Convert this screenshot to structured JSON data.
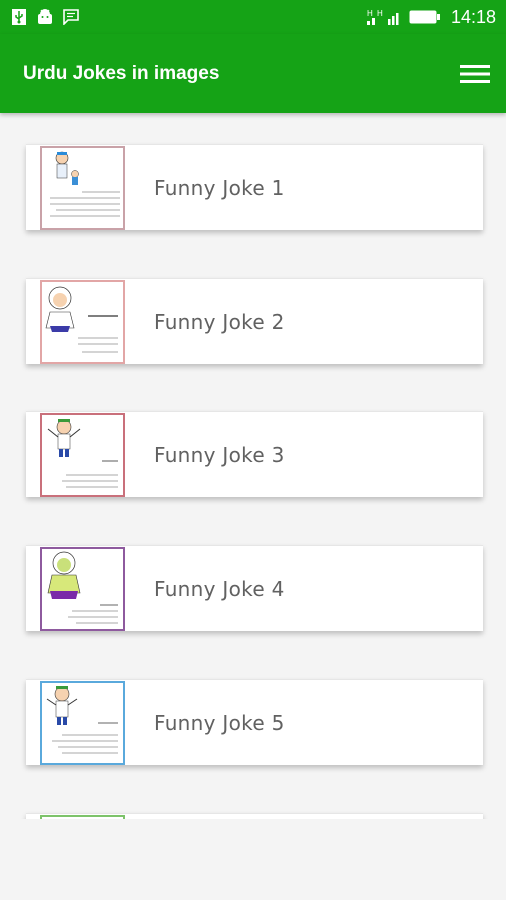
{
  "status_bar": {
    "time": "14:18",
    "left_icons": [
      "usb-icon",
      "android-icon",
      "message-icon"
    ],
    "right_icons": [
      "signal-h-icon",
      "signal-bars-icon",
      "battery-icon"
    ]
  },
  "app_bar": {
    "title": "Urdu Jokes in images",
    "menu_icon": "hamburger-menu-icon",
    "background_color": "#15a316"
  },
  "jokes": [
    {
      "label": "Funny Joke 1",
      "thumb_border": "#c9a2a8",
      "thumb_icon": "cartoon-boy-icon"
    },
    {
      "label": "Funny Joke 2",
      "thumb_border": "#e2a6a6",
      "thumb_icon": "cartoon-girl-icon"
    },
    {
      "label": "Funny Joke 3",
      "thumb_border": "#c9707b",
      "thumb_icon": "cartoon-boy-icon"
    },
    {
      "label": "Funny Joke 4",
      "thumb_border": "#8e5a9e",
      "thumb_icon": "cartoon-girl-icon"
    },
    {
      "label": "Funny Joke 5",
      "thumb_border": "#5aa9dc",
      "thumb_icon": "cartoon-boy-icon"
    },
    {
      "label": "",
      "thumb_border": "#7dc36a",
      "thumb_icon": "cartoon-boy-icon"
    }
  ]
}
